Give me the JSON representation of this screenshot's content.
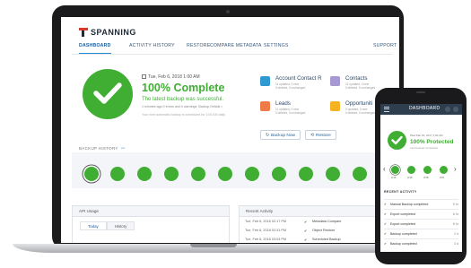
{
  "app": {
    "logo_text": "SPANNING",
    "nav": [
      "DASHBOARD",
      "ACTIVITY HISTORY",
      "RESTORE",
      "COMPARE METADATA",
      "SETTINGS",
      "SUPPORT"
    ]
  },
  "status": {
    "date": "Tue, Feb 6, 2018 1:00 AM",
    "title": "100% Complete",
    "subtitle": "The latest backup was successful.",
    "detail": "1 minutes ago  0 errors and 0 warnings. Backup Details >",
    "next": "Your next automatic backup is scheduled for 1:00 AM daily."
  },
  "objects": [
    {
      "name": "Account Contact R",
      "meta_line1": "11 updated, 0 new",
      "meta_line2": "0 deleted, 0 unchanged",
      "color": "#2f9ad1"
    },
    {
      "name": "Contacts",
      "meta_line1": "21 updated, 0 new",
      "meta_line2": "0 deleted, 0 unchanged",
      "color": "#a79ad3"
    },
    {
      "name": "Leads",
      "meta_line1": "11 updated, 0 new",
      "meta_line2": "0 deleted, 0 unchanged",
      "color": "#f07b4a"
    },
    {
      "name": "Opportuniti",
      "meta_line1": "0 updated, 0 new",
      "meta_line2": "0 deleted, 0 unchanged",
      "color": "#f5b324"
    }
  ],
  "actions": {
    "backup_now": "Backup Now",
    "restore": "Restore"
  },
  "backup_history": {
    "label": "BACKUP HISTORY",
    "count": 11
  },
  "api_usage": {
    "title": "API Usage",
    "tabs": [
      "Today",
      "History"
    ]
  },
  "recent_activity": {
    "title": "Recent Activity",
    "rows": [
      {
        "date": "Tue, Feb 6, 2018 02:17 PM",
        "action": "Metadata Compare"
      },
      {
        "date": "Tue, Feb 6, 2018 02:31 PM",
        "action": "Object Restore"
      },
      {
        "date": "Tue, Feb 6, 2018 03:04 PM",
        "action": "Scheduled Backup"
      }
    ]
  },
  "mobile": {
    "header_title": "DASHBOARD",
    "date": "Wed Mar 20, 2017 1:00 AM",
    "status": "100% Protected",
    "status_sub": "Last backup completed",
    "history_labels": [
      "2/16",
      "2/18",
      "3/18",
      "3/21"
    ],
    "section": "RECENT ACTIVITY",
    "rows": [
      {
        "text": "Manual Backup completed",
        "age": "5 hr"
      },
      {
        "text": "Export completed",
        "age": "6 hr"
      },
      {
        "text": "Export completed",
        "age": "8 hr"
      },
      {
        "text": "Backup completed",
        "age": "2 d"
      },
      {
        "text": "Backup completed",
        "age": "3 d"
      }
    ]
  }
}
